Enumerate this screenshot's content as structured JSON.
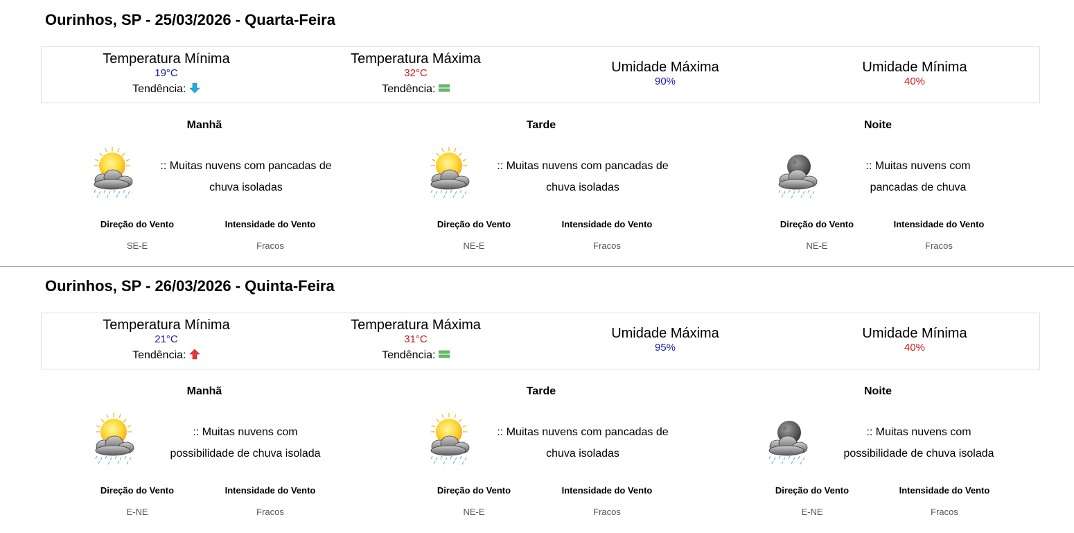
{
  "days": [
    {
      "title": "Ourinhos, SP - 25/03/2026 - Quarta-Feira",
      "temp_min_label": "Temperatura Mínima",
      "temp_min": "19°C",
      "temp_max_label": "Temperatura Máxima",
      "temp_max": "32°C",
      "trend_label": "Tendência:",
      "trend_min_icon": "arrow-down-icon",
      "trend_max_icon": "stable-icon",
      "hum_max_label": "Umidade Máxima",
      "hum_max": "90%",
      "hum_min_label": "Umidade Mínima",
      "hum_min": "40%",
      "periods": [
        {
          "name": "Manhã",
          "icon": "sun-cloud-rain-icon",
          "desc": ":: Muitas nuvens com pancadas de chuva isoladas",
          "wind_dir_label": "Direção do Vento",
          "wind_dir": "SE-E",
          "wind_int_label": "Intensidade do Vento",
          "wind_int": "Fracos"
        },
        {
          "name": "Tarde",
          "icon": "sun-cloud-rain-icon",
          "desc": ":: Muitas nuvens com pancadas de chuva isoladas",
          "wind_dir_label": "Direção do Vento",
          "wind_dir": "NE-E",
          "wind_int_label": "Intensidade do Vento",
          "wind_int": "Fracos"
        },
        {
          "name": "Noite",
          "icon": "moon-cloud-rain-icon",
          "desc": ":: Muitas nuvens com pancadas de chuva",
          "wind_dir_label": "Direção do Vento",
          "wind_dir": "NE-E",
          "wind_int_label": "Intensidade do Vento",
          "wind_int": "Fracos"
        }
      ]
    },
    {
      "title": "Ourinhos, SP - 26/03/2026 - Quinta-Feira",
      "temp_min_label": "Temperatura Mínima",
      "temp_min": "21°C",
      "temp_max_label": "Temperatura Máxima",
      "temp_max": "31°C",
      "trend_label": "Tendência:",
      "trend_min_icon": "arrow-up-icon",
      "trend_max_icon": "stable-icon",
      "hum_max_label": "Umidade Máxima",
      "hum_max": "95%",
      "hum_min_label": "Umidade Mínima",
      "hum_min": "40%",
      "periods": [
        {
          "name": "Manhã",
          "icon": "sun-cloud-rain-icon",
          "desc": ":: Muitas nuvens com possibilidade de chuva isolada",
          "wind_dir_label": "Direção do Vento",
          "wind_dir": "E-NE",
          "wind_int_label": "Intensidade do Vento",
          "wind_int": "Fracos"
        },
        {
          "name": "Tarde",
          "icon": "sun-cloud-rain-icon",
          "desc": ":: Muitas nuvens com pancadas de chuva isoladas",
          "wind_dir_label": "Direção do Vento",
          "wind_dir": "NE-E",
          "wind_int_label": "Intensidade do Vento",
          "wind_int": "Fracos"
        },
        {
          "name": "Noite",
          "icon": "moon-cloud-rain-icon",
          "desc": ":: Muitas nuvens com possibilidade de chuva isolada",
          "wind_dir_label": "Direção do Vento",
          "wind_dir": "E-NE",
          "wind_int_label": "Intensidade do Vento",
          "wind_int": "Fracos"
        }
      ]
    }
  ],
  "colors": {
    "min_value": "#1a1ab3",
    "max_value": "#cc1a1a",
    "trend_down": "#2aa7e0",
    "trend_up": "#e53935",
    "trend_stable": "#4caf50"
  }
}
